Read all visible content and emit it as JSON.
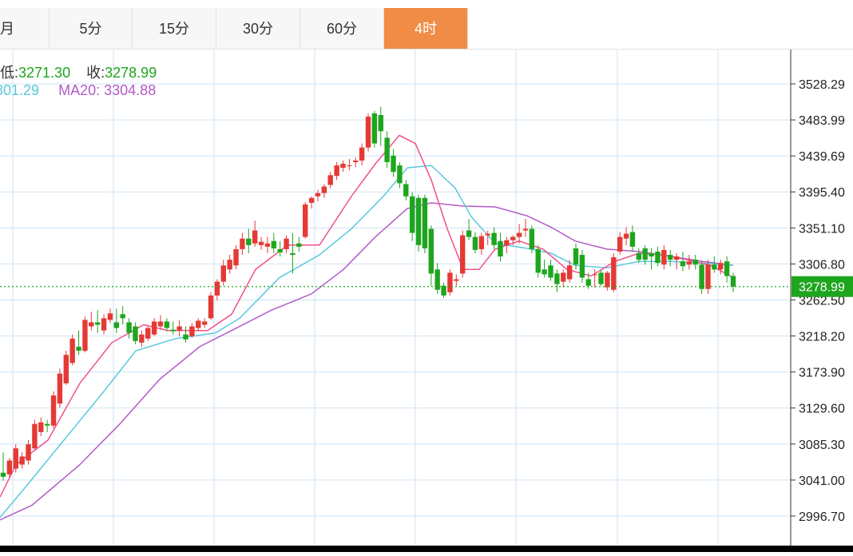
{
  "tabs": [
    {
      "label": "月",
      "active": false
    },
    {
      "label": "5分",
      "active": false
    },
    {
      "label": "15分",
      "active": false
    },
    {
      "label": "30分",
      "active": false
    },
    {
      "label": "60分",
      "active": false
    },
    {
      "label": "4时",
      "active": true
    }
  ],
  "info": {
    "low_label": "低:",
    "low_value": "3271.30",
    "close_label": "收:",
    "close_value": "3278.99",
    "ma10_value": "301.29",
    "ma20_label": "MA20:",
    "ma20_value": "3304.88"
  },
  "colors": {
    "up": "#e53935",
    "down": "#1ea51e",
    "ma5": "#f0508c",
    "ma10": "#5ac8dc",
    "ma20": "#b45ac8",
    "accent": "#f08c45",
    "price_tag": "#1ea51e",
    "grid": "#cfe3f3"
  },
  "chart_data": {
    "type": "candlestick",
    "y_ticks": [
      "3528.29",
      "3483.99",
      "3439.69",
      "3395.40",
      "3351.10",
      "3306.80",
      "3262.50",
      "3218.20",
      "3173.90",
      "3129.60",
      "3085.30",
      "3041.00",
      "2996.70"
    ],
    "ylim": [
      2952.4,
      3572.6
    ],
    "current_price": "3278.99",
    "candles": [
      [
        3050,
        3075,
        3040,
        3045
      ],
      [
        3048,
        3068,
        3044,
        3065
      ],
      [
        3055,
        3085,
        3050,
        3080
      ],
      [
        3060,
        3075,
        3055,
        3070
      ],
      [
        3065,
        3090,
        3060,
        3085
      ],
      [
        3080,
        3115,
        3078,
        3110
      ],
      [
        3100,
        3118,
        3095,
        3112
      ],
      [
        3110,
        3115,
        3100,
        3108
      ],
      [
        3108,
        3150,
        3105,
        3145
      ],
      [
        3135,
        3178,
        3130,
        3172
      ],
      [
        3160,
        3200,
        3158,
        3195
      ],
      [
        3185,
        3220,
        3182,
        3215
      ],
      [
        3205,
        3225,
        3195,
        3200
      ],
      [
        3200,
        3242,
        3198,
        3238
      ],
      [
        3230,
        3248,
        3225,
        3235
      ],
      [
        3235,
        3250,
        3222,
        3232
      ],
      [
        3225,
        3245,
        3220,
        3240
      ],
      [
        3238,
        3252,
        3234,
        3246
      ],
      [
        3235,
        3252,
        3222,
        3228
      ],
      [
        3245,
        3255,
        3232,
        3240
      ],
      [
        3235,
        3240,
        3215,
        3222
      ],
      [
        3230,
        3235,
        3208,
        3212
      ],
      [
        3210,
        3225,
        3205,
        3220
      ],
      [
        3215,
        3230,
        3212,
        3228
      ],
      [
        3220,
        3240,
        3218,
        3236
      ],
      [
        3230,
        3244,
        3226,
        3236
      ],
      [
        3236,
        3240,
        3224,
        3228
      ],
      [
        3226,
        3236,
        3220,
        3224
      ],
      [
        3225,
        3238,
        3218,
        3230
      ],
      [
        3220,
        3230,
        3210,
        3214
      ],
      [
        3218,
        3234,
        3216,
        3230
      ],
      [
        3228,
        3240,
        3224,
        3237
      ],
      [
        3232,
        3240,
        3228,
        3236
      ],
      [
        3240,
        3272,
        3238,
        3268
      ],
      [
        3268,
        3288,
        3262,
        3285
      ],
      [
        3285,
        3312,
        3280,
        3305
      ],
      [
        3300,
        3318,
        3295,
        3312
      ],
      [
        3305,
        3330,
        3300,
        3325
      ],
      [
        3325,
        3345,
        3318,
        3338
      ],
      [
        3338,
        3350,
        3320,
        3330
      ],
      [
        3332,
        3360,
        3328,
        3348
      ],
      [
        3330,
        3340,
        3324,
        3334
      ],
      [
        3328,
        3340,
        3320,
        3332
      ],
      [
        3335,
        3345,
        3320,
        3326
      ],
      [
        3325,
        3335,
        3316,
        3321
      ],
      [
        3325,
        3342,
        3320,
        3338
      ],
      [
        3320,
        3345,
        3295,
        3318
      ],
      [
        3332,
        3340,
        3322,
        3328
      ],
      [
        3340,
        3383,
        3338,
        3380
      ],
      [
        3382,
        3390,
        3375,
        3388
      ],
      [
        3390,
        3398,
        3384,
        3394
      ],
      [
        3394,
        3405,
        3388,
        3402
      ],
      [
        3404,
        3420,
        3400,
        3416
      ],
      [
        3415,
        3432,
        3410,
        3428
      ],
      [
        3425,
        3434,
        3420,
        3430
      ],
      [
        3428,
        3436,
        3422,
        3428
      ],
      [
        3432,
        3438,
        3426,
        3434
      ],
      [
        3434,
        3455,
        3428,
        3450
      ],
      [
        3450,
        3492,
        3445,
        3488
      ],
      [
        3492,
        3495,
        3450,
        3455
      ],
      [
        3490,
        3500,
        3452,
        3470
      ],
      [
        3462,
        3470,
        3425,
        3432
      ],
      [
        3440,
        3448,
        3414,
        3420
      ],
      [
        3428,
        3432,
        3400,
        3406
      ],
      [
        3405,
        3410,
        3385,
        3390
      ],
      [
        3390,
        3395,
        3335,
        3345
      ],
      [
        3388,
        3392,
        3322,
        3330
      ],
      [
        3388,
        3392,
        3320,
        3326
      ],
      [
        3350,
        3354,
        3280,
        3295
      ],
      [
        3300,
        3308,
        3270,
        3275
      ],
      [
        3280,
        3284,
        3265,
        3268
      ],
      [
        3272,
        3300,
        3268,
        3296
      ],
      [
        3286,
        3294,
        3280,
        3288
      ],
      [
        3295,
        3348,
        3290,
        3342
      ],
      [
        3348,
        3362,
        3336,
        3340
      ],
      [
        3340,
        3346,
        3320,
        3324
      ],
      [
        3325,
        3345,
        3318,
        3341
      ],
      [
        3342,
        3348,
        3330,
        3344
      ],
      [
        3345,
        3352,
        3325,
        3330
      ],
      [
        3335,
        3345,
        3310,
        3316
      ],
      [
        3330,
        3340,
        3320,
        3336
      ],
      [
        3336,
        3342,
        3330,
        3340
      ],
      [
        3340,
        3356,
        3332,
        3345
      ],
      [
        3348,
        3362,
        3340,
        3350
      ],
      [
        3350,
        3354,
        3320,
        3325
      ],
      [
        3325,
        3330,
        3290,
        3296
      ],
      [
        3300,
        3312,
        3290,
        3294
      ],
      [
        3305,
        3312,
        3286,
        3290
      ],
      [
        3295,
        3300,
        3272,
        3282
      ],
      [
        3285,
        3300,
        3278,
        3296
      ],
      [
        3288,
        3312,
        3284,
        3305
      ],
      [
        3326,
        3332,
        3300,
        3306
      ],
      [
        3318,
        3324,
        3284,
        3290
      ],
      [
        3288,
        3296,
        3276,
        3280
      ],
      [
        3294,
        3300,
        3278,
        3294
      ],
      [
        3296,
        3300,
        3280,
        3282
      ],
      [
        3278,
        3298,
        3274,
        3296
      ],
      [
        3275,
        3320,
        3272,
        3315
      ],
      [
        3322,
        3346,
        3318,
        3340
      ],
      [
        3338,
        3352,
        3330,
        3344
      ],
      [
        3346,
        3354,
        3322,
        3328
      ],
      [
        3320,
        3326,
        3308,
        3312
      ],
      [
        3326,
        3330,
        3306,
        3312
      ],
      [
        3320,
        3326,
        3300,
        3316
      ],
      [
        3322,
        3328,
        3304,
        3308
      ],
      [
        3306,
        3330,
        3300,
        3324
      ],
      [
        3318,
        3324,
        3304,
        3312
      ],
      [
        3312,
        3320,
        3300,
        3316
      ],
      [
        3310,
        3322,
        3298,
        3304
      ],
      [
        3306,
        3318,
        3300,
        3310
      ],
      [
        3312,
        3318,
        3300,
        3306
      ],
      [
        3306,
        3310,
        3270,
        3276
      ],
      [
        3276,
        3312,
        3270,
        3306
      ],
      [
        3306,
        3316,
        3296,
        3300
      ],
      [
        3300,
        3312,
        3294,
        3308
      ],
      [
        3310,
        3316,
        3284,
        3292
      ],
      [
        3292,
        3296,
        3272,
        3279
      ]
    ],
    "ma5": [
      [
        0,
        3020
      ],
      [
        20,
        3060
      ],
      [
        60,
        3090
      ],
      [
        100,
        3160
      ],
      [
        140,
        3210
      ],
      [
        180,
        3232
      ],
      [
        210,
        3225
      ],
      [
        260,
        3225
      ],
      [
        290,
        3245
      ],
      [
        320,
        3300
      ],
      [
        360,
        3330
      ],
      [
        400,
        3330
      ],
      [
        440,
        3390
      ],
      [
        470,
        3430
      ],
      [
        500,
        3465
      ],
      [
        520,
        3455
      ],
      [
        540,
        3410
      ],
      [
        560,
        3350
      ],
      [
        580,
        3300
      ],
      [
        600,
        3300
      ],
      [
        620,
        3325
      ],
      [
        650,
        3335
      ],
      [
        680,
        3325
      ],
      [
        710,
        3300
      ],
      [
        740,
        3292
      ],
      [
        770,
        3310
      ],
      [
        800,
        3320
      ],
      [
        830,
        3318
      ],
      [
        860,
        3312
      ],
      [
        890,
        3305
      ],
      [
        918,
        3290
      ]
    ],
    "ma10": [
      [
        0,
        2995
      ],
      [
        30,
        3030
      ],
      [
        80,
        3090
      ],
      [
        130,
        3150
      ],
      [
        170,
        3200
      ],
      [
        220,
        3215
      ],
      [
        270,
        3222
      ],
      [
        300,
        3240
      ],
      [
        350,
        3290
      ],
      [
        400,
        3318
      ],
      [
        440,
        3350
      ],
      [
        480,
        3390
      ],
      [
        510,
        3425
      ],
      [
        540,
        3428
      ],
      [
        570,
        3400
      ],
      [
        590,
        3365
      ],
      [
        620,
        3332
      ],
      [
        660,
        3326
      ],
      [
        690,
        3320
      ],
      [
        720,
        3305
      ],
      [
        760,
        3302
      ],
      [
        800,
        3310
      ],
      [
        840,
        3310
      ],
      [
        880,
        3308
      ],
      [
        918,
        3305
      ]
    ],
    "ma20": [
      [
        0,
        2992
      ],
      [
        40,
        3010
      ],
      [
        100,
        3060
      ],
      [
        150,
        3110
      ],
      [
        200,
        3165
      ],
      [
        250,
        3205
      ],
      [
        290,
        3225
      ],
      [
        340,
        3250
      ],
      [
        390,
        3270
      ],
      [
        430,
        3300
      ],
      [
        470,
        3340
      ],
      [
        510,
        3375
      ],
      [
        540,
        3382
      ],
      [
        580,
        3378
      ],
      [
        620,
        3377
      ],
      [
        660,
        3366
      ],
      [
        690,
        3352
      ],
      [
        720,
        3335
      ],
      [
        760,
        3325
      ],
      [
        800,
        3322
      ],
      [
        840,
        3316
      ],
      [
        880,
        3310
      ],
      [
        918,
        3305
      ]
    ]
  }
}
